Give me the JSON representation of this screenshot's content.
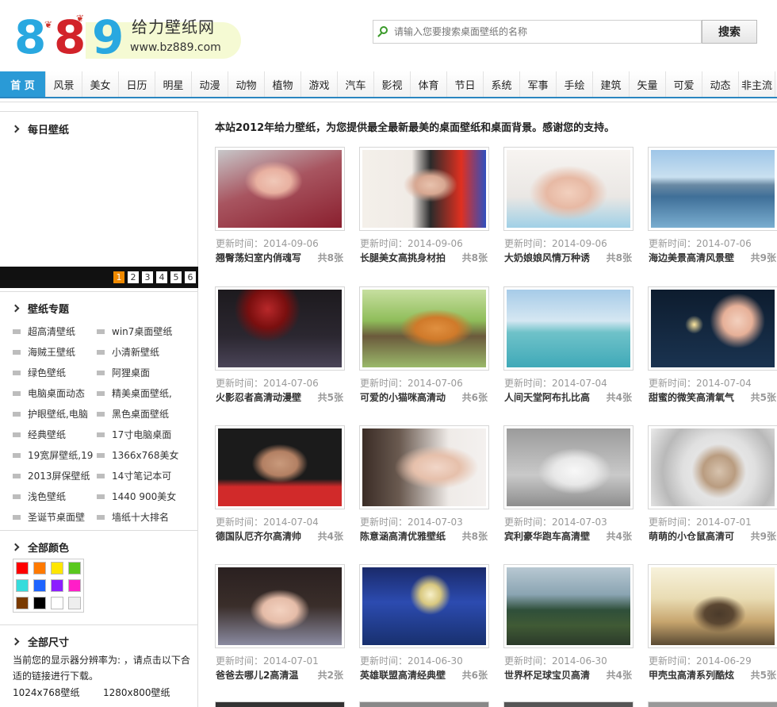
{
  "header": {
    "logo_digits": [
      "8",
      "8",
      "9"
    ],
    "logo_title": "给力壁纸网",
    "logo_url": "www.bz889.com",
    "search_placeholder": "请输入您要搜索桌面壁纸的名称",
    "search_button": "搜索"
  },
  "nav": [
    "首 页",
    "风景",
    "美女",
    "日历",
    "明星",
    "动漫",
    "动物",
    "植物",
    "游戏",
    "汽车",
    "影视",
    "体育",
    "节日",
    "系统",
    "军事",
    "手绘",
    "建筑",
    "矢量",
    "可爱",
    "动态",
    "非主流"
  ],
  "sidebar": {
    "daily_title": "每日壁纸",
    "pages": [
      "1",
      "2",
      "3",
      "4",
      "5",
      "6"
    ],
    "topics_title": "壁纸专题",
    "topics": [
      [
        "超高清壁纸",
        "win7桌面壁纸"
      ],
      [
        "海贼王壁纸",
        "小清新壁纸"
      ],
      [
        "绿色壁纸",
        "阿狸桌面"
      ],
      [
        "电脑桌面动态",
        "精美桌面壁纸,"
      ],
      [
        "护眼壁纸,电脑",
        "黑色桌面壁纸"
      ],
      [
        "经典壁纸",
        "17寸电脑桌面"
      ],
      [
        "19宽屏壁纸,19",
        "1366x768美女"
      ],
      [
        "2013屏保壁纸",
        "14寸笔记本可"
      ],
      [
        "浅色壁纸",
        "1440 900美女"
      ],
      [
        "圣诞节桌面壁",
        "墙纸十大排名"
      ]
    ],
    "colors_title": "全部颜色",
    "colors": [
      "#ff0000",
      "#ff7a00",
      "#ffe600",
      "#5ac81e",
      "#36dcdc",
      "#1e64ff",
      "#8c1eff",
      "#ff1ec8",
      "#7a3a00",
      "#000000",
      "#ffffff",
      "#eeeeee"
    ],
    "sizes_title": "全部尺寸",
    "sizes_text": "当前您的显示器分辨率为: ，请点击以下合适的链接进行下载。",
    "size_links": [
      "1024x768壁纸",
      "1280x800壁纸"
    ]
  },
  "main": {
    "intro": "本站2012年给力壁纸，为您提供最全最新最美的桌面壁纸和桌面背景。感谢您的支持。",
    "items": [
      {
        "date": "更新时间：2014-09-06",
        "title": "翘臀荡妇室内俏魂写",
        "count": "共8张"
      },
      {
        "date": "更新时间：2014-09-06",
        "title": "长腿美女高挑身材拍",
        "count": "共8张"
      },
      {
        "date": "更新时间：2014-09-06",
        "title": "大奶娘娘风情万种诱",
        "count": "共8张"
      },
      {
        "date": "更新时间：2014-07-06",
        "title": "海边美景高清风景壁",
        "count": "共9张"
      },
      {
        "date": "更新时间：2014-07-06",
        "title": "火影忍者高清动漫壁",
        "count": "共5张"
      },
      {
        "date": "更新时间：2014-07-06",
        "title": "可爱的小猫咪高清动",
        "count": "共6张"
      },
      {
        "date": "更新时间：2014-07-04",
        "title": "人间天堂阿布扎比高",
        "count": "共4张"
      },
      {
        "date": "更新时间：2014-07-04",
        "title": "甜蜜的微笑高清氧气",
        "count": "共5张"
      },
      {
        "date": "更新时间：2014-07-04",
        "title": "德国队厄齐尔高清帅",
        "count": "共4张"
      },
      {
        "date": "更新时间：2014-07-03",
        "title": "陈意涵高清优雅壁纸",
        "count": "共8张"
      },
      {
        "date": "更新时间：2014-07-03",
        "title": "宾利豪华跑车高清壁",
        "count": "共4张"
      },
      {
        "date": "更新时间：2014-07-01",
        "title": "萌萌的小仓鼠高清可",
        "count": "共9张"
      },
      {
        "date": "更新时间：2014-07-01",
        "title": "爸爸去哪儿2高清温",
        "count": "共2张"
      },
      {
        "date": "更新时间：2014-06-30",
        "title": "英雄联盟高清经典壁",
        "count": "共6张"
      },
      {
        "date": "更新时间：2014-06-30",
        "title": "世界杯足球宝贝高清",
        "count": "共4张"
      },
      {
        "date": "更新时间：2014-06-29",
        "title": "甲壳虫高清系列酷炫",
        "count": "共5张"
      }
    ]
  }
}
